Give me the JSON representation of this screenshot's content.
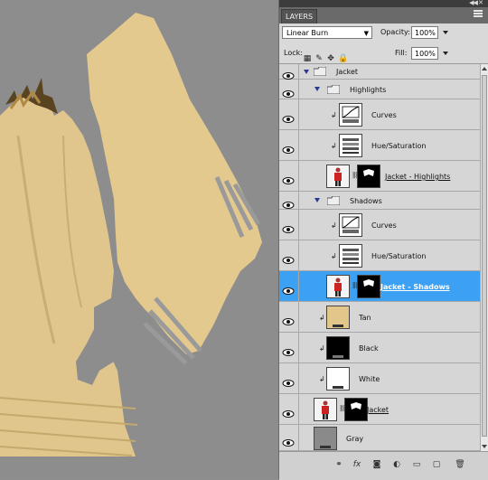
{
  "panel": {
    "tab_label": "LAYERS",
    "blend_mode": "Linear Burn",
    "opacity_label": "Opacity:",
    "opacity_value": "100%",
    "lock_label": "Lock:",
    "fill_label": "Fill:",
    "fill_value": "100%"
  },
  "layers": [
    {
      "name": "Jacket",
      "kind": "group"
    },
    {
      "name": "Highlights",
      "kind": "group"
    },
    {
      "name": "Curves",
      "kind": "adjustment"
    },
    {
      "name": "Hue/Saturation",
      "kind": "adjustment"
    },
    {
      "name": "Jacket - Highlights",
      "kind": "masked"
    },
    {
      "name": "Shadows",
      "kind": "group"
    },
    {
      "name": "Curves",
      "kind": "adjustment"
    },
    {
      "name": "Hue/Saturation",
      "kind": "adjustment"
    },
    {
      "name": "Jacket - Shadows",
      "kind": "masked",
      "selected": true
    },
    {
      "name": "Tan",
      "kind": "fill",
      "color": "#e3c68a"
    },
    {
      "name": "Black",
      "kind": "fill",
      "color": "#000000"
    },
    {
      "name": "White",
      "kind": "fill",
      "color": "#ffffff"
    },
    {
      "name": "Jacket",
      "kind": "masked"
    },
    {
      "name": "Gray",
      "kind": "fill",
      "color": "#8a8a8a"
    }
  ],
  "bottom_icons": [
    "link-icon",
    "fx-icon",
    "mask-icon",
    "adjustment-icon",
    "folder-icon",
    "new-layer-icon",
    "trash-icon"
  ],
  "bottom_glyphs": [
    "⚭",
    "fx",
    "◙",
    "◐",
    "▭",
    "▢",
    "🗑"
  ],
  "colors": {
    "selected": "#3ca0f3",
    "jacket": "#e2c88e",
    "background": "#8d8d8d"
  }
}
